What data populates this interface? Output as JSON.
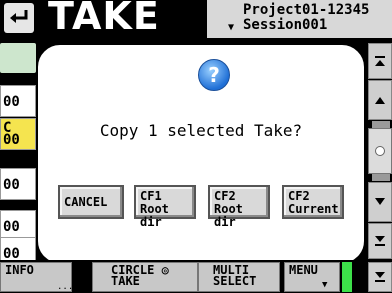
{
  "header": {
    "title": "TAKE",
    "project": "Project01-12345",
    "session": "Session001"
  },
  "list": {
    "rows": [
      "00",
      "00",
      "00",
      "00",
      "00"
    ],
    "selected_row_top": "C",
    "selected_row_bottom": "00"
  },
  "dialog": {
    "message": "Copy 1 selected Take?",
    "buttons": {
      "cancel": "CANCEL",
      "cf1_line1": "CF1",
      "cf1_line2": "Root dir",
      "cf2_line1": "CF2",
      "cf2_line2": "Root dir",
      "cf2c_line1": "CF2",
      "cf2c_line2": "Current"
    }
  },
  "bottom_bar": {
    "info": "INFO",
    "info_suffix": "...",
    "circle_line1": "CIRCLE",
    "circle_line2": "TAKE",
    "multi_line1": "MULTI",
    "multi_line2": "SELECT",
    "menu": "MENU"
  },
  "colors": {
    "accent_green": "#3de04a",
    "selected_row": "#f5e44f",
    "question_icon": "#1f6fd6"
  }
}
